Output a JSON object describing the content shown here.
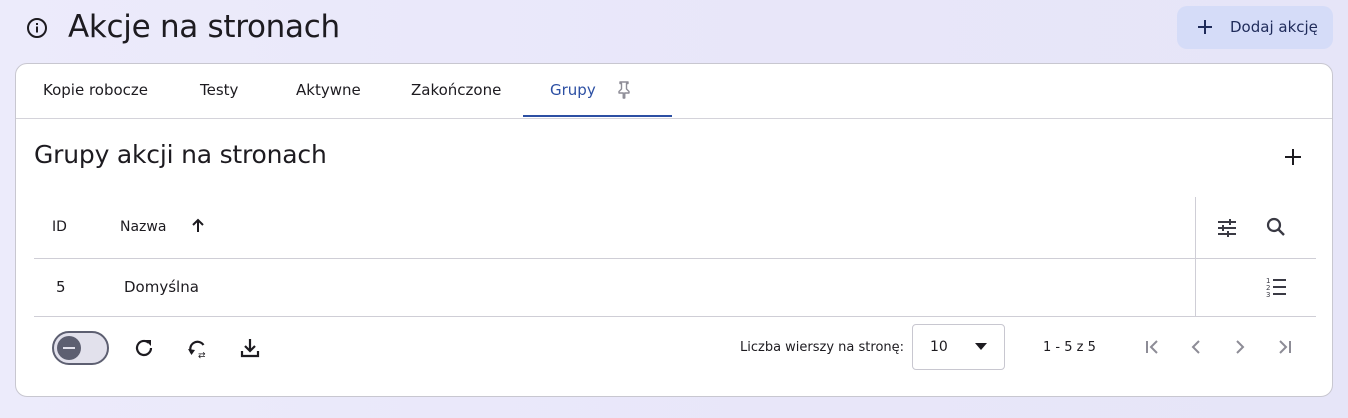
{
  "header": {
    "title": "Akcje na stronach",
    "add_button_label": "Dodaj akcję"
  },
  "tabs": [
    {
      "label": "Kopie robocze"
    },
    {
      "label": "Testy"
    },
    {
      "label": "Aktywne"
    },
    {
      "label": "Zakończone"
    },
    {
      "label": "Grupy",
      "active": true
    }
  ],
  "section": {
    "title": "Grupy akcji na stronach"
  },
  "table": {
    "columns": [
      "ID",
      "Nazwa"
    ],
    "sort": {
      "column": "Nazwa",
      "direction": "ascending"
    },
    "rows": [
      {
        "id": "5",
        "name": "Domyślna"
      }
    ]
  },
  "footer": {
    "rows_per_page_label": "Liczba wierszy na stronę:",
    "rows_per_page_value": "10",
    "range_label": "1 - 5 z 5"
  },
  "icons": {
    "info": "info-circle-icon",
    "add": "plus-icon",
    "pin": "pin-icon",
    "sort": "arrow-up-icon",
    "columns": "sliders-icon",
    "search": "search-icon",
    "row_action": "numbered-list-icon",
    "refresh": "refresh-icon",
    "auto_refresh": "auto-refresh-icon",
    "download": "download-icon",
    "first_page": "first-page-icon",
    "prev_page": "chevron-left-icon",
    "next_page": "chevron-right-icon",
    "last_page": "last-page-icon"
  },
  "colors": {
    "accent": "#2c4fa3",
    "primary_button_bg": "#d5dcf8",
    "background": "#e8e6f9"
  }
}
